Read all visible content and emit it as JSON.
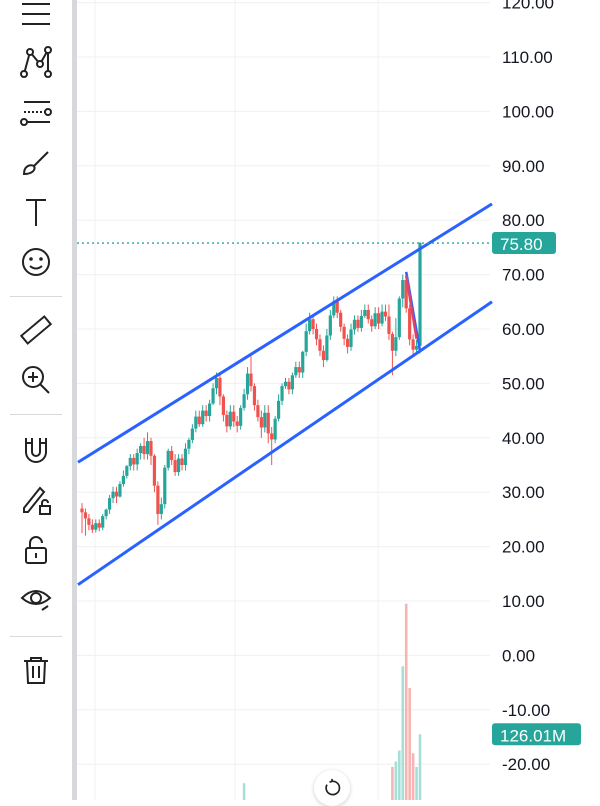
{
  "toolbar": {
    "tools": [
      {
        "name": "crosshair-lines-icon"
      },
      {
        "name": "pattern-tool-icon"
      },
      {
        "name": "fib-tool-icon"
      },
      {
        "name": "brush-icon"
      },
      {
        "name": "text-tool-icon"
      },
      {
        "name": "emoji-icon"
      },
      {
        "name": "ruler-icon"
      },
      {
        "name": "zoom-in-icon"
      },
      {
        "name": "magnet-icon"
      },
      {
        "name": "lock-drawing-icon"
      },
      {
        "name": "unlock-icon"
      },
      {
        "name": "eye-icon"
      },
      {
        "name": "trash-icon"
      }
    ]
  },
  "chart_data": {
    "type": "candlestick",
    "y_ticks": [
      "120.00",
      "110.00",
      "100.00",
      "90.00",
      "80.00",
      "70.00",
      "60.00",
      "50.00",
      "40.00",
      "30.00",
      "20.00",
      "10.00",
      "0.00",
      "-10.00",
      "-20.00"
    ],
    "ylim": [
      -25,
      122
    ],
    "last_price_label": "75.80",
    "last_price": 75.8,
    "volume_label": "126.01M",
    "volume_value_axis": -14.5,
    "colors": {
      "up": "#26a69a",
      "down": "#ef5350",
      "channel": "#2962ff",
      "price_badge": "#26a69a",
      "volume_up": "#a7dfd7",
      "volume_down": "#f6b4b2"
    },
    "candles": [
      [
        27.0,
        26.3
      ],
      [
        26.3,
        25.2
      ],
      [
        25.2,
        24.0
      ],
      [
        24.0,
        23.1
      ],
      [
        23.1,
        24.3
      ],
      [
        24.3,
        23.5
      ],
      [
        23.5,
        25.6
      ],
      [
        25.6,
        26.8
      ],
      [
        26.8,
        28.9
      ],
      [
        28.9,
        30.1
      ],
      [
        30.1,
        29.2
      ],
      [
        29.2,
        31.5
      ],
      [
        31.5,
        33.0
      ],
      [
        33.0,
        34.8
      ],
      [
        34.8,
        36.3
      ],
      [
        36.3,
        35.1
      ],
      [
        35.1,
        37.2
      ],
      [
        37.2,
        38.5
      ],
      [
        38.5,
        37.0
      ],
      [
        37.0,
        39.4
      ],
      [
        39.4,
        36.7
      ],
      [
        36.7,
        31.2
      ],
      [
        31.2,
        26.0
      ],
      [
        26.0,
        27.8
      ],
      [
        27.8,
        34.5
      ],
      [
        34.5,
        37.6
      ],
      [
        37.6,
        35.9
      ],
      [
        35.9,
        33.7
      ],
      [
        33.7,
        36.2
      ],
      [
        36.2,
        35.0
      ],
      [
        35.0,
        38.0
      ],
      [
        38.0,
        39.6
      ],
      [
        39.6,
        41.7
      ],
      [
        41.7,
        43.9
      ],
      [
        43.9,
        42.5
      ],
      [
        42.5,
        45.0
      ],
      [
        45.0,
        44.0
      ],
      [
        44.0,
        46.3
      ],
      [
        46.3,
        49.1
      ],
      [
        49.1,
        51.0
      ],
      [
        51.0,
        47.6
      ],
      [
        47.6,
        44.2
      ],
      [
        44.2,
        42.1
      ],
      [
        42.1,
        44.8
      ],
      [
        44.8,
        43.0
      ],
      [
        43.0,
        42.2
      ],
      [
        42.2,
        45.5
      ],
      [
        45.5,
        48.0
      ],
      [
        48.0,
        51.8
      ],
      [
        51.8,
        49.5
      ],
      [
        49.5,
        46.0
      ],
      [
        46.0,
        43.8
      ],
      [
        43.8,
        41.9
      ],
      [
        41.9,
        44.6
      ],
      [
        44.6,
        40.8
      ],
      [
        40.8,
        39.7
      ],
      [
        39.7,
        43.5
      ],
      [
        43.5,
        46.8
      ],
      [
        46.8,
        49.5
      ],
      [
        49.5,
        50.3
      ],
      [
        50.3,
        48.9
      ],
      [
        48.9,
        51.5
      ],
      [
        51.5,
        53.0
      ],
      [
        53.0,
        52.0
      ],
      [
        52.0,
        55.8
      ],
      [
        55.8,
        59.6
      ],
      [
        59.6,
        61.8
      ],
      [
        61.8,
        60.0
      ],
      [
        60.0,
        58.1
      ],
      [
        58.1,
        56.0
      ],
      [
        56.0,
        54.3
      ],
      [
        54.3,
        58.8
      ],
      [
        58.8,
        62.5
      ],
      [
        62.5,
        65.1
      ],
      [
        65.1,
        63.0
      ],
      [
        63.0,
        60.4
      ],
      [
        60.4,
        58.2
      ],
      [
        58.2,
        56.7
      ],
      [
        56.7,
        59.9
      ],
      [
        59.9,
        61.7
      ],
      [
        61.7,
        60.2
      ],
      [
        60.2,
        62.4
      ],
      [
        62.4,
        63.5
      ],
      [
        63.5,
        61.8
      ],
      [
        61.8,
        60.5
      ],
      [
        60.5,
        62.9
      ],
      [
        62.9,
        61.0
      ],
      [
        61.0,
        63.2
      ],
      [
        63.2,
        62.3
      ],
      [
        62.3,
        59.1
      ],
      [
        59.1,
        56.0
      ],
      [
        56.0,
        58.5
      ],
      [
        58.5,
        65.6
      ],
      [
        65.6,
        69.0
      ],
      [
        69.0,
        63.8
      ],
      [
        63.8,
        58.1
      ],
      [
        58.1,
        56.2
      ],
      [
        56.2,
        56.9
      ],
      [
        56.9,
        75.8
      ]
    ],
    "wicks": [
      [
        28,
        22.5
      ],
      [
        27,
        22
      ],
      [
        26,
        23
      ],
      [
        25,
        22.5
      ],
      [
        25,
        22.6
      ],
      [
        25,
        22.8
      ],
      [
        26,
        23
      ],
      [
        27,
        25
      ],
      [
        29.5,
        26
      ],
      [
        31,
        28
      ],
      [
        31,
        28
      ],
      [
        32,
        29
      ],
      [
        34,
        31
      ],
      [
        35,
        32.5
      ],
      [
        37,
        34
      ],
      [
        37,
        34
      ],
      [
        38,
        34
      ],
      [
        39,
        36
      ],
      [
        40,
        36
      ],
      [
        41,
        36
      ],
      [
        40,
        35
      ],
      [
        37,
        30
      ],
      [
        32,
        24
      ],
      [
        29,
        25
      ],
      [
        35,
        27
      ],
      [
        38,
        34
      ],
      [
        38.5,
        35
      ],
      [
        37,
        33
      ],
      [
        37,
        33
      ],
      [
        37,
        34
      ],
      [
        39,
        34
      ],
      [
        40,
        37
      ],
      [
        42.5,
        39
      ],
      [
        45,
        41
      ],
      [
        45,
        42
      ],
      [
        46,
        42
      ],
      [
        46,
        43
      ],
      [
        47,
        43
      ],
      [
        50,
        46
      ],
      [
        52,
        48
      ],
      [
        52,
        46
      ],
      [
        48,
        43
      ],
      [
        45,
        41
      ],
      [
        46,
        41.5
      ],
      [
        46,
        42
      ],
      [
        44,
        41
      ],
      [
        46,
        41.5
      ],
      [
        49,
        45
      ],
      [
        53,
        47
      ],
      [
        55,
        48.5
      ],
      [
        50,
        45
      ],
      [
        47,
        43
      ],
      [
        45,
        40
      ],
      [
        46,
        41
      ],
      [
        46,
        39
      ],
      [
        42,
        35
      ],
      [
        44,
        39
      ],
      [
        48,
        43
      ],
      [
        50,
        46
      ],
      [
        51,
        49
      ],
      [
        51,
        48
      ],
      [
        52,
        48
      ],
      [
        54,
        51
      ],
      [
        54,
        51
      ],
      [
        56,
        51
      ],
      [
        61,
        55
      ],
      [
        63,
        59
      ],
      [
        62.5,
        59
      ],
      [
        61,
        57
      ],
      [
        59,
        55
      ],
      [
        57,
        53
      ],
      [
        60,
        54
      ],
      [
        63.5,
        58
      ],
      [
        66,
        62
      ],
      [
        66,
        62
      ],
      [
        63.5,
        59.5
      ],
      [
        61,
        57
      ],
      [
        59,
        55.5
      ],
      [
        61,
        56
      ],
      [
        62.5,
        59
      ],
      [
        62.5,
        59.5
      ],
      [
        63.5,
        59.5
      ],
      [
        64.5,
        62
      ],
      [
        64.5,
        61
      ],
      [
        62.5,
        59.5
      ],
      [
        64,
        60
      ],
      [
        64,
        60
      ],
      [
        64.5,
        60.5
      ],
      [
        64.5,
        61.5
      ],
      [
        64.5,
        58
      ],
      [
        59.5,
        51.5
      ],
      [
        62,
        55
      ],
      [
        66,
        58
      ],
      [
        70,
        64
      ],
      [
        70,
        63
      ],
      [
        64.5,
        57
      ],
      [
        59,
        55
      ],
      [
        58,
        55.5
      ],
      [
        76,
        55.5
      ]
    ],
    "volumes": [
      0,
      0,
      0,
      0,
      0,
      0,
      0,
      0,
      0,
      0,
      0,
      0,
      0,
      0,
      0,
      0,
      0,
      0,
      0,
      0,
      0,
      0,
      0,
      0,
      0,
      0,
      0,
      0,
      0,
      0,
      0,
      0,
      0,
      0,
      0,
      0,
      0,
      0,
      0,
      0,
      0,
      0,
      0,
      0,
      0,
      0,
      0,
      -23.5,
      0,
      0,
      0,
      0,
      0,
      0,
      0,
      0,
      0,
      0,
      0,
      0,
      0,
      0,
      0,
      0,
      0,
      0,
      0,
      0,
      0,
      0,
      0,
      0,
      0,
      0,
      0,
      0,
      0,
      0,
      0,
      0,
      0,
      0,
      0,
      0,
      0,
      0,
      0,
      0,
      0,
      0,
      -20.5,
      -19.5,
      -17.5,
      -2,
      9.5,
      -6,
      -18,
      -20.5,
      -14.5
    ],
    "channel_upper": [
      [
        35.5,
        0
      ],
      [
        83,
        1
      ]
    ],
    "channel_lower": [
      [
        13.0,
        0
      ],
      [
        65,
        1
      ]
    ],
    "pattern_lines": [
      [
        [
          70.5,
          94
        ],
        [
          56.0,
          98
        ]
      ],
      [
        [
          69.8,
          94
        ],
        [
          58.2,
          97
        ]
      ]
    ]
  }
}
